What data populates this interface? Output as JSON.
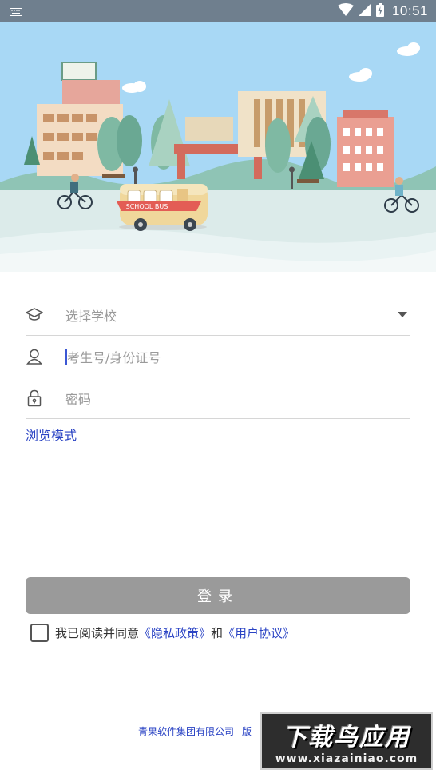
{
  "status_bar": {
    "time": "10:51",
    "icons": [
      "keyboard-icon",
      "wifi-icon",
      "signal-icon",
      "battery-icon"
    ]
  },
  "banner": {
    "bus_sign": "SCHOOL BUS"
  },
  "form": {
    "school_placeholder": "选择学校",
    "id_placeholder": "考生号/身份证号",
    "password_placeholder": "密码",
    "browse_mode_label": "浏览模式"
  },
  "login_button_label": "登录",
  "agreement": {
    "prefix": "我已阅读并同意",
    "privacy_link": "《隐私政策》",
    "conjunction": "和",
    "user_agreement_link": "《用户协议》"
  },
  "footer": {
    "company": "青果软件集团有限公司",
    "tail": "版"
  },
  "watermark": {
    "title": "下载鸟应用",
    "url": "www.xiazainiao.com"
  },
  "colors": {
    "status_bar": "#6f7f8e",
    "sky": "#a8d8f5",
    "link": "#2a43c4",
    "login_button": "#9a9a9a"
  }
}
